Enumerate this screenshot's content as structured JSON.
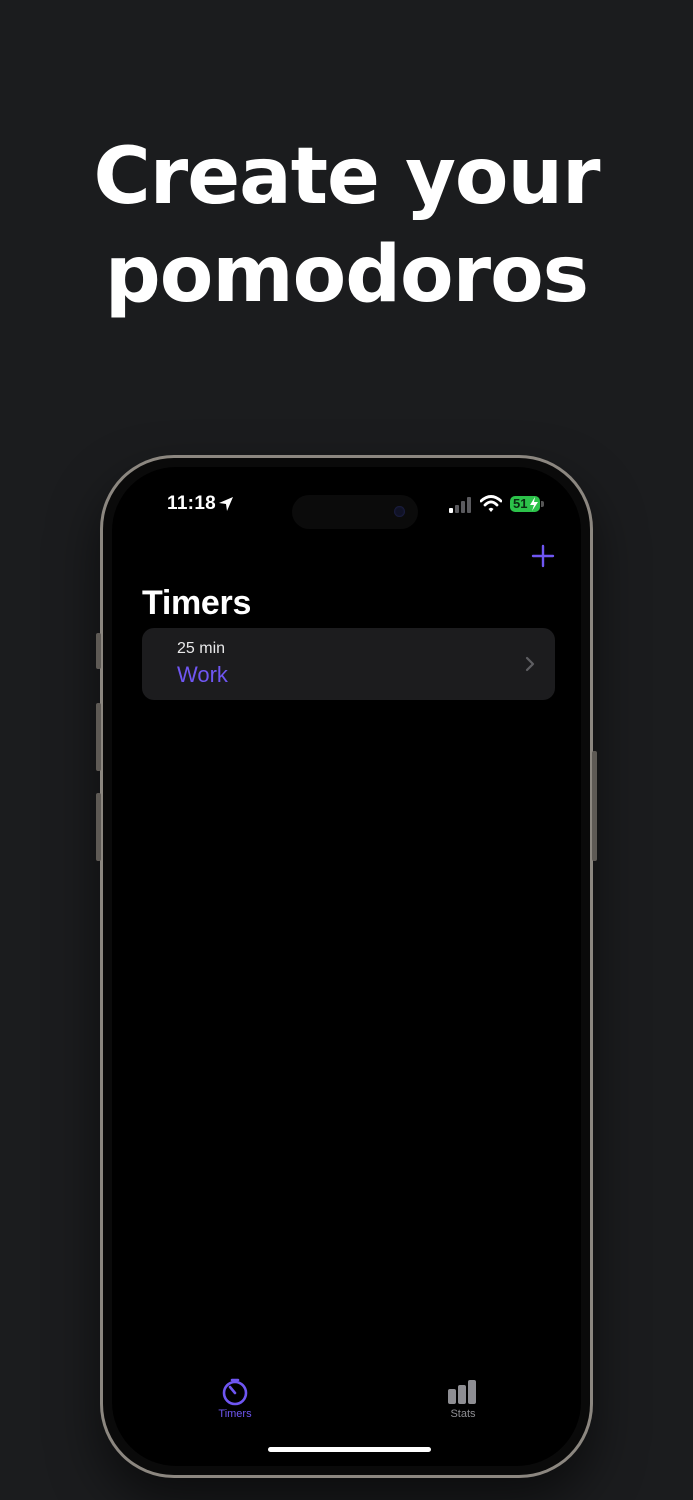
{
  "headline": {
    "line1": "Create your",
    "line2": "pomodoros"
  },
  "status_bar": {
    "time": "11:18",
    "battery": "51"
  },
  "nav": {
    "title": "Timers",
    "add_icon": "plus-icon"
  },
  "timers": [
    {
      "duration": "25 min",
      "name": "Work"
    }
  ],
  "tab_bar": {
    "items": [
      {
        "label": "Timers",
        "icon": "timer-icon",
        "selected": true
      },
      {
        "label": "Stats",
        "icon": "bar-chart-icon",
        "selected": false
      }
    ]
  },
  "colors": {
    "accent": "#6f56f2",
    "background": "#1b1c1e",
    "screen": "#000000",
    "card": "#1c1c1e",
    "battery": "#2cc24a"
  }
}
